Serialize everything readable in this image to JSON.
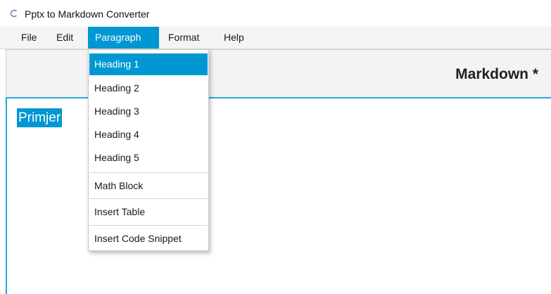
{
  "window": {
    "title": "Pptx to Markdown Converter",
    "icon": "loading-spinner-icon"
  },
  "menubar": {
    "items": [
      {
        "label": "File"
      },
      {
        "label": "Edit"
      },
      {
        "label": "Paragraph",
        "active": true
      },
      {
        "label": "Format"
      },
      {
        "label": "Help"
      }
    ]
  },
  "paragraph_menu": {
    "headings": [
      {
        "label": "Heading 1",
        "highlighted": true
      },
      {
        "label": "Heading 2"
      },
      {
        "label": "Heading 3"
      },
      {
        "label": "Heading 4"
      },
      {
        "label": "Heading 5"
      }
    ],
    "math_block": "Math Block",
    "insert_table": "Insert Table",
    "insert_code_snippet": "Insert Code Snippet"
  },
  "pane": {
    "title": "Markdown *"
  },
  "editor": {
    "selected_text": "Primjer"
  },
  "colors": {
    "accent": "#0097d3",
    "editor_border": "#2aa7d8",
    "menubar_bg": "#f4f4f4"
  }
}
